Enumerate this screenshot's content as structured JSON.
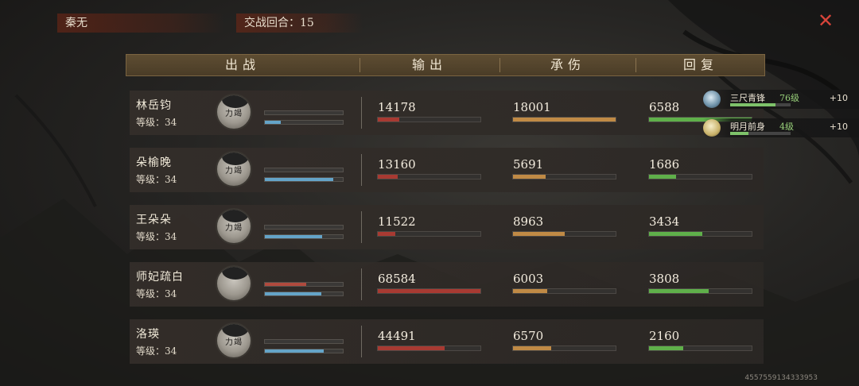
{
  "top": {
    "player_name": "秦无",
    "rounds_label": "交战回合：15",
    "close_icon": "close-icon"
  },
  "columns": {
    "fighter": "出战",
    "output": "输出",
    "damage_taken": "承伤",
    "healing": "回复"
  },
  "colors": {
    "output_bar": "#a83a32",
    "taken_bar": "#c08a45",
    "heal_bar": "#5fb04a",
    "hp_bar": "#b04a3e",
    "mp_bar": "#64a4c8"
  },
  "rows": [
    {
      "name": "林岳钧",
      "level": "等级：34",
      "avatar_stamp": "力竭",
      "hp": 0.0,
      "mp": 0.2,
      "output": "14178",
      "output_frac": 0.21,
      "taken": "18001",
      "taken_frac": 1.0,
      "heal": "6588",
      "heal_frac": 1.0
    },
    {
      "name": "朵榆晚",
      "level": "等级：34",
      "avatar_stamp": "力竭",
      "hp": 0.0,
      "mp": 0.88,
      "output": "13160",
      "output_frac": 0.19,
      "taken": "5691",
      "taken_frac": 0.32,
      "heal": "1686",
      "heal_frac": 0.26
    },
    {
      "name": "王朵朵",
      "level": "等级：34",
      "avatar_stamp": "力竭",
      "hp": 0.0,
      "mp": 0.73,
      "output": "11522",
      "output_frac": 0.17,
      "taken": "8963",
      "taken_frac": 0.5,
      "heal": "3434",
      "heal_frac": 0.52
    },
    {
      "name": "师妃疏白",
      "level": "等级：34",
      "avatar_stamp": "",
      "hp": 0.53,
      "mp": 0.72,
      "output": "68584",
      "output_frac": 1.0,
      "taken": "6003",
      "taken_frac": 0.33,
      "heal": "3808",
      "heal_frac": 0.58
    },
    {
      "name": "洛瑛",
      "level": "等级：34",
      "avatar_stamp": "力竭",
      "hp": 0.0,
      "mp": 0.76,
      "output": "44491",
      "output_frac": 0.65,
      "taken": "6570",
      "taken_frac": 0.37,
      "heal": "2160",
      "heal_frac": 0.33
    }
  ],
  "buffs": [
    {
      "name": "三尺青锋",
      "level": "76级",
      "bonus": "+10",
      "bar": 0.75,
      "icon": "sword-icon"
    },
    {
      "name": "明月前身",
      "level": "4级",
      "bonus": "+10",
      "bar": 0.3,
      "icon": "skull-icon"
    }
  ],
  "footer": {
    "id": "4557559134333953"
  }
}
